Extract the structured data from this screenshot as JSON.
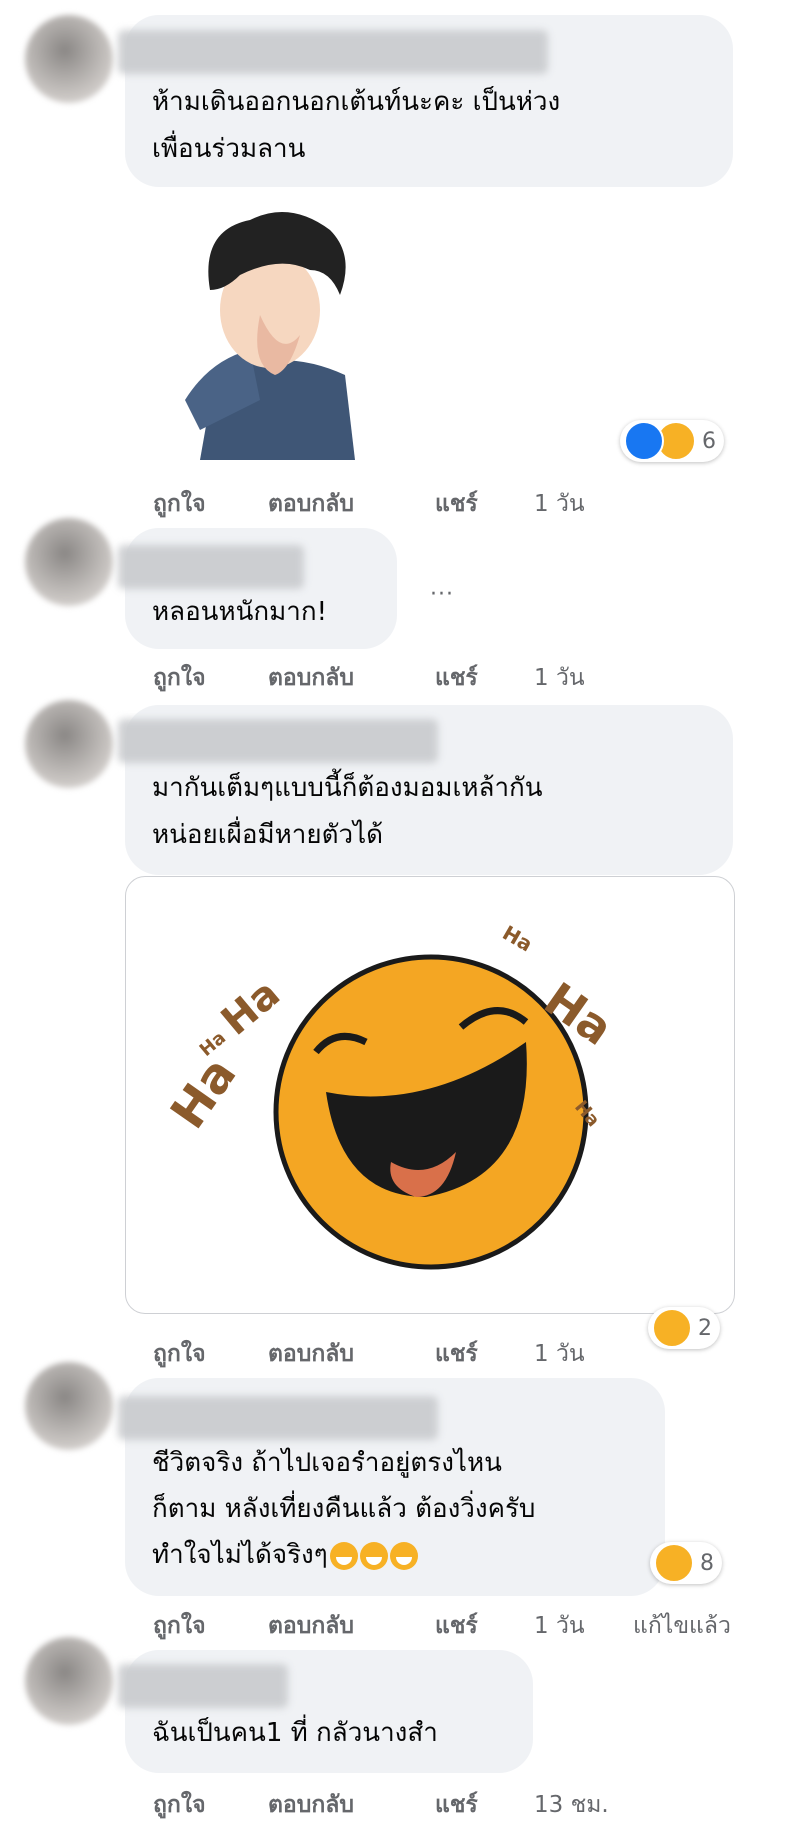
{
  "comments": [
    {
      "text_lines": [
        "ห้ามเดินออกนอกเต้นท์นะคะ เป็นห่วง",
        "เพื่อนร่วมลาน"
      ],
      "actions": [
        "ถูกใจ",
        "ตอบกลับ",
        "แชร์",
        "1 วัน"
      ],
      "reactions": {
        "icons": [
          "like-icon",
          "haha-icon"
        ],
        "count": "6"
      },
      "attachment": "sticker-man-laughing"
    },
    {
      "text_lines": [
        "หลอนหนักมาก!"
      ],
      "more_label": "···",
      "actions": [
        "ถูกใจ",
        "ตอบกลับ",
        "แชร์",
        "1 วัน"
      ]
    },
    {
      "text_lines": [
        "มากันเต็มๆแบบนี้ก็ต้องมอมเหล้ากัน",
        "หน่อยเผื่อมีหายตัวได้"
      ],
      "actions": [
        "ถูกใจ",
        "ตอบกลับ",
        "แชร์",
        "1 วัน"
      ],
      "reactions": {
        "icons": [
          "haha-icon"
        ],
        "count": "2"
      },
      "attachment": {
        "type": "haha-image",
        "texts": [
          "Ha",
          "Ha",
          "Ha",
          "Ha",
          "Ha",
          "Ha"
        ]
      }
    },
    {
      "text_lines": [
        "ชีวิตจริง ถ้าไปเจอรำอยู่ตรงไหน",
        "ก็ตาม หลังเที่ยงคืนแล้ว ต้องวิ่งครับ",
        "ทำใจไม่ได้จริงๆ"
      ],
      "actions": [
        "ถูกใจ",
        "ตอบกลับ",
        "แชร์",
        "1 วัน",
        "แก้ไขแล้ว"
      ],
      "reactions": {
        "icons": [
          "haha-icon"
        ],
        "count": "8"
      }
    },
    {
      "text_lines": [
        "ฉันเป็นคน1 ที่ กลัวนางสำ"
      ],
      "actions": [
        "ถูกใจ",
        "ตอบกลับ",
        "แชร์",
        "13 ชม."
      ]
    }
  ],
  "colors": {
    "bubble": "#f0f2f5",
    "meta": "#65676b",
    "like": "#1877f2",
    "haha": "#f7b125"
  }
}
